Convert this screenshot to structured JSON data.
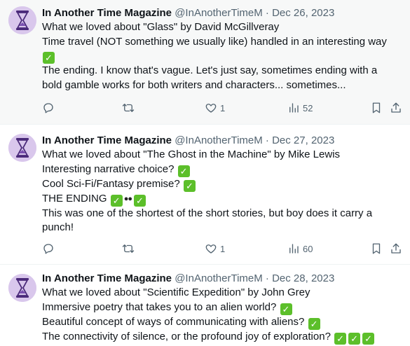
{
  "tweets": [
    {
      "author": "In Another Time Magazine",
      "handle": "@InAnotherTimeM",
      "separator": "·",
      "date": "Dec 26, 2023",
      "lines": [
        "What we loved about \"Glass\" by David McGillveray",
        "Time travel (NOT something we usually like) handled in an interesting way",
        "",
        "The ending.  I know that's vague.  Let's just say, sometimes ending with a",
        "bold gamble works for both writers and characters... sometimes..."
      ],
      "likes": "1",
      "views": "52"
    },
    {
      "author": "In Another Time Magazine",
      "handle": "@InAnotherTimeM",
      "separator": "·",
      "date": "Dec 27, 2023",
      "lines": [
        "What we loved about \"The Ghost in the Machine\" by Mike Lewis",
        "Interesting narrative choice? ",
        "Cool Sci-Fi/Fantasy premise? ",
        "THE ENDING ",
        "This was one of the shortest of the short stories, but boy does it carry a",
        "punch!"
      ],
      "likes": "1",
      "views": "60"
    },
    {
      "author": "In Another Time Magazine",
      "handle": "@InAnotherTimeM",
      "separator": "·",
      "date": "Dec 28, 2023",
      "lines": [
        "What we loved about \"Scientific Expedition\" by John Grey",
        "Immersive poetry that takes you to an alien world? ",
        "Beautiful concept of ways of communicating with aliens? ",
        "The connectivity of silence, or the profound joy of exploration? "
      ]
    }
  ],
  "emoji": {
    "check": "✓",
    "check_color": "#5cbf2a",
    "eyes": "👀"
  },
  "colors": {
    "muted_text": "#536471",
    "avatar_bg": "#d9c7ec",
    "hourglass": "#4b2a7a",
    "highlight_bg": "#f7f8f8"
  }
}
